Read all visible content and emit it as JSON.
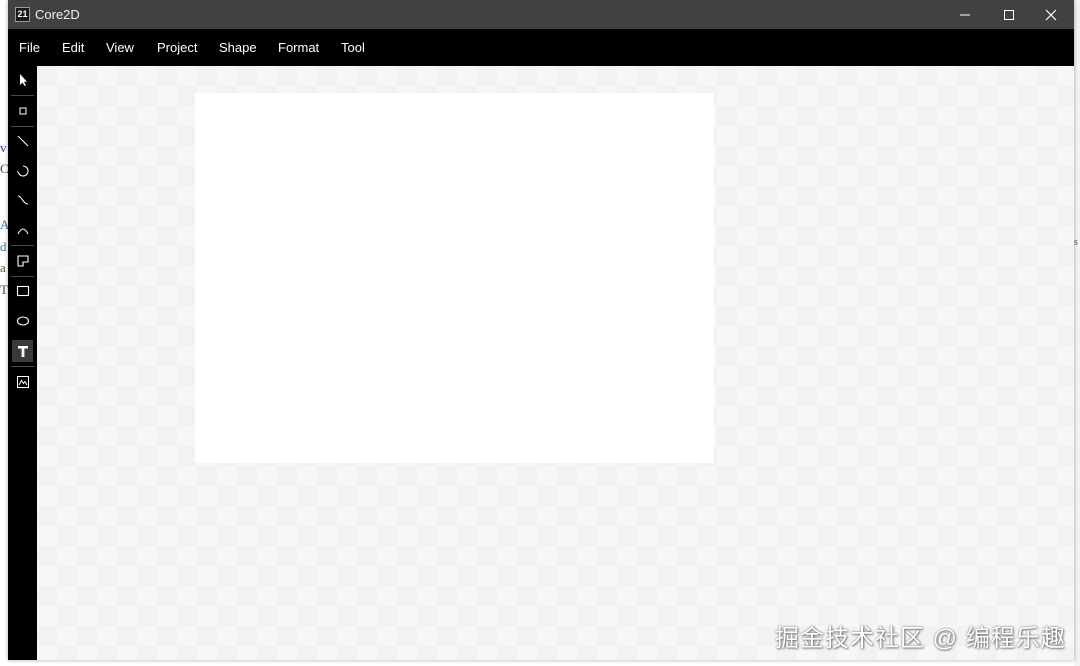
{
  "window": {
    "title": "Core2D",
    "icon_glyph": "21"
  },
  "menu": [
    "File",
    "Edit",
    "View",
    "Project",
    "Shape",
    "Format",
    "Tool"
  ],
  "tools": [
    {
      "name": "selection-icon"
    },
    {
      "name": "point-icon"
    },
    {
      "name": "line-icon"
    },
    {
      "name": "arc-icon"
    },
    {
      "name": "cubic-bezier-icon"
    },
    {
      "name": "quadratic-bezier-icon"
    },
    {
      "name": "path-icon"
    },
    {
      "name": "rectangle-icon"
    },
    {
      "name": "ellipse-icon"
    },
    {
      "name": "text-icon",
      "active": true
    },
    {
      "name": "image-icon"
    }
  ],
  "background_glyphs": [
    "v",
    "C",
    "A",
    "d",
    "a",
    "T",
    "s"
  ],
  "watermark": "掘金技术社区 @ 编程乐趣",
  "colors": {
    "titlebar": "#414141",
    "menubar": "#000000",
    "canvas": "#f2f2f2",
    "page": "#ffffff"
  }
}
